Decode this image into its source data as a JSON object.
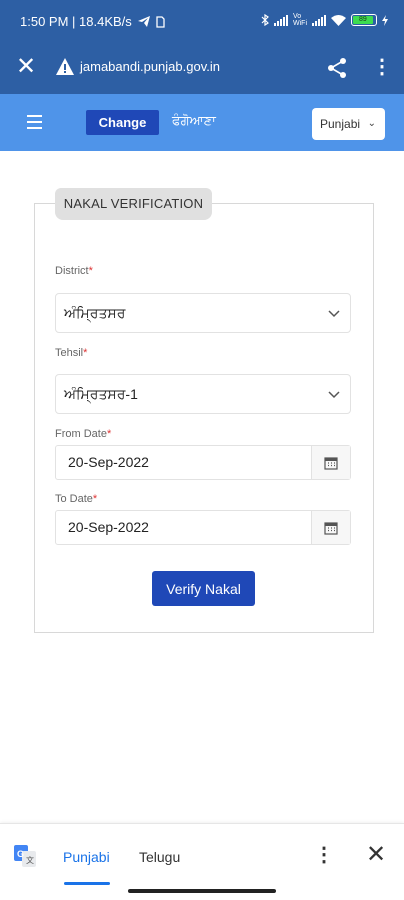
{
  "status_bar": {
    "time_speed": "1:50 PM | 18.4KB/s",
    "battery": "89",
    "icons": [
      "telegram-icon",
      "sim-icon",
      "bluetooth-icon",
      "signal-icon",
      "volte-icon",
      "wifi-icon",
      "battery-icon",
      "charging-icon"
    ]
  },
  "browser": {
    "url": "jamabandi.punjab.gov.in",
    "close_icon": "close-icon",
    "warning_icon": "warning-icon",
    "share_icon": "share-icon",
    "more_icon": "more-vert-icon"
  },
  "header": {
    "change_label": "Change",
    "alt_lang_label": "ਫੰਗੋਆਣਾ",
    "language_selected": "Punjabi"
  },
  "form": {
    "title": "NAKAL VERIFICATION",
    "district_label": "District",
    "district_value": "ਅੰਮ੍ਰਿਤਸਰ",
    "tehsil_label": "Tehsil",
    "tehsil_value": "ਅੰਮ੍ਰਿਤਸਰ-1",
    "from_date_label": "From Date",
    "from_date_value": "20-Sep-2022",
    "to_date_label": "To Date",
    "to_date_value": "20-Sep-2022",
    "required_mark": "*",
    "submit_label": "Verify Nakal"
  },
  "translate_bar": {
    "tabs": [
      {
        "label": "Punjabi",
        "active": true
      },
      {
        "label": "Telugu",
        "active": false
      }
    ]
  },
  "colors": {
    "browser_bar": "#2d5fa4",
    "site_header": "#4f94e9",
    "primary_button": "#1f48b7",
    "translate_accent": "#1a73e8"
  }
}
